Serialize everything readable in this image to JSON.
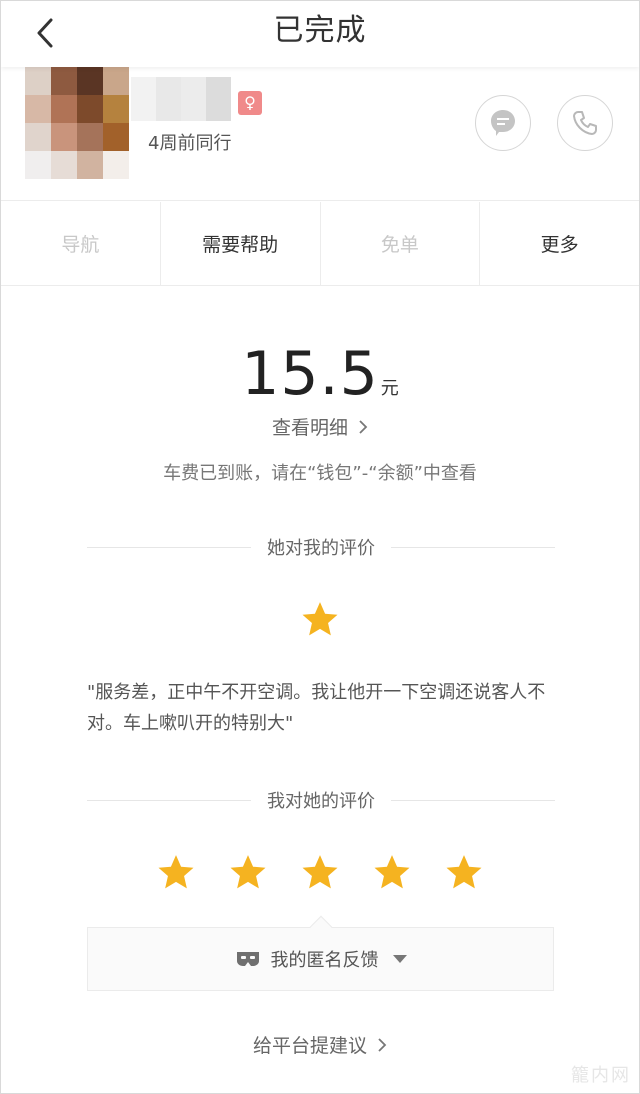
{
  "header": {
    "title": "已完成"
  },
  "driver": {
    "ride_ago": "4周前同行",
    "gender_symbol": "♀",
    "avatar_pixels": [
      "#ddd0c6",
      "#8e5a40",
      "#5a3524",
      "#c9a68a",
      "#d7b8a6",
      "#b07356",
      "#7d4a2b",
      "#b5823e",
      "#e0d4cc",
      "#c9947c",
      "#a5735a",
      "#a2612a",
      "#f0eeee",
      "#e6dcd6",
      "#d1b3a0",
      "#f3eeea"
    ],
    "name_pixels": [
      "#f2f2f2",
      "#e8e8e8",
      "#ececec",
      "#dcdcdc"
    ]
  },
  "actions": [
    {
      "label": "导航",
      "enabled": false
    },
    {
      "label": "需要帮助",
      "enabled": true
    },
    {
      "label": "免单",
      "enabled": false
    },
    {
      "label": "更多",
      "enabled": true
    }
  ],
  "fare": {
    "amount": "15.5",
    "unit": "元",
    "detail_link": "查看明细",
    "notice": "车费已到账，请在“钱包”-“余额”中查看"
  },
  "rating_of_me": {
    "title": "她对我的评价",
    "stars": 1,
    "comment": "\"服务差，正中午不开空调。我让他开一下空调还说客人不对。车上嗽叭开的特别大\""
  },
  "my_rating": {
    "title": "我对她的评价",
    "stars": 5
  },
  "feedback": {
    "label": "我的匿名反馈"
  },
  "suggest_link": "给平台提建议",
  "watermark": "籠内网",
  "colors": {
    "star": "#f5b320",
    "gender_badge": "#f08a8a",
    "divider": "#ececec"
  }
}
